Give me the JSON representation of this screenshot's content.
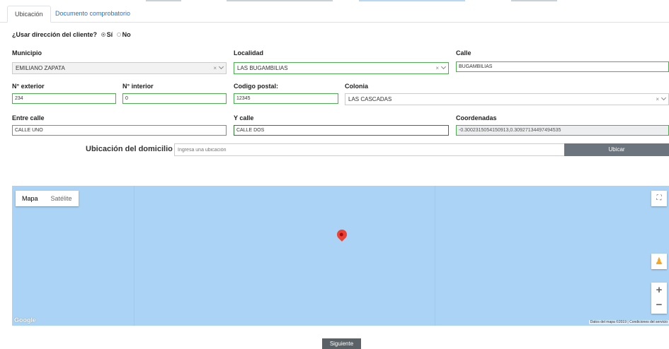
{
  "tabs": [
    {
      "label": "Ubicación"
    },
    {
      "label": "Documento comprobatorio"
    }
  ],
  "use_client_address": {
    "question": "¿Usar dirección del cliente?",
    "option_yes": "Sí",
    "option_no": "No",
    "selected": "Sí"
  },
  "form": {
    "municipio": {
      "label": "Municipio",
      "value": "EMILIANO ZAPATA"
    },
    "localidad": {
      "label": "Localidad",
      "value": "LAS BUGAMBILIAS"
    },
    "calle": {
      "label": "Calle",
      "value": "BUGAMBILIAS"
    },
    "num_exterior": {
      "label": "N° exterior",
      "value": "234"
    },
    "num_interior": {
      "label": "N° interior",
      "value": "0"
    },
    "codigo_postal": {
      "label": "Codigo postal:",
      "value": "12345"
    },
    "colonia": {
      "label": "Colonia",
      "value": "LAS CASCADAS"
    },
    "entre_calle": {
      "label": "Entre calle",
      "value": "CALLE UNO"
    },
    "y_calle": {
      "label": "Y calle",
      "value": "CALLE DOS"
    },
    "coordenadas": {
      "label": "Coordenadas",
      "value": "-0.3002315054150913,0.30927134497494535"
    }
  },
  "location_search": {
    "label": "Ubicación del domicilio",
    "placeholder": "Ingresa una ubicación",
    "button": "Ubicar"
  },
  "map": {
    "type_map": "Mapa",
    "type_satellite": "Satélite",
    "selected_type": "Mapa",
    "logo": "Google",
    "attribution": "Datos del mapa ©2019",
    "terms": "Condiciones del servicio",
    "water_color": "#aad3f5",
    "pin_color": "#ea4335"
  },
  "next_button": "Siguiente"
}
